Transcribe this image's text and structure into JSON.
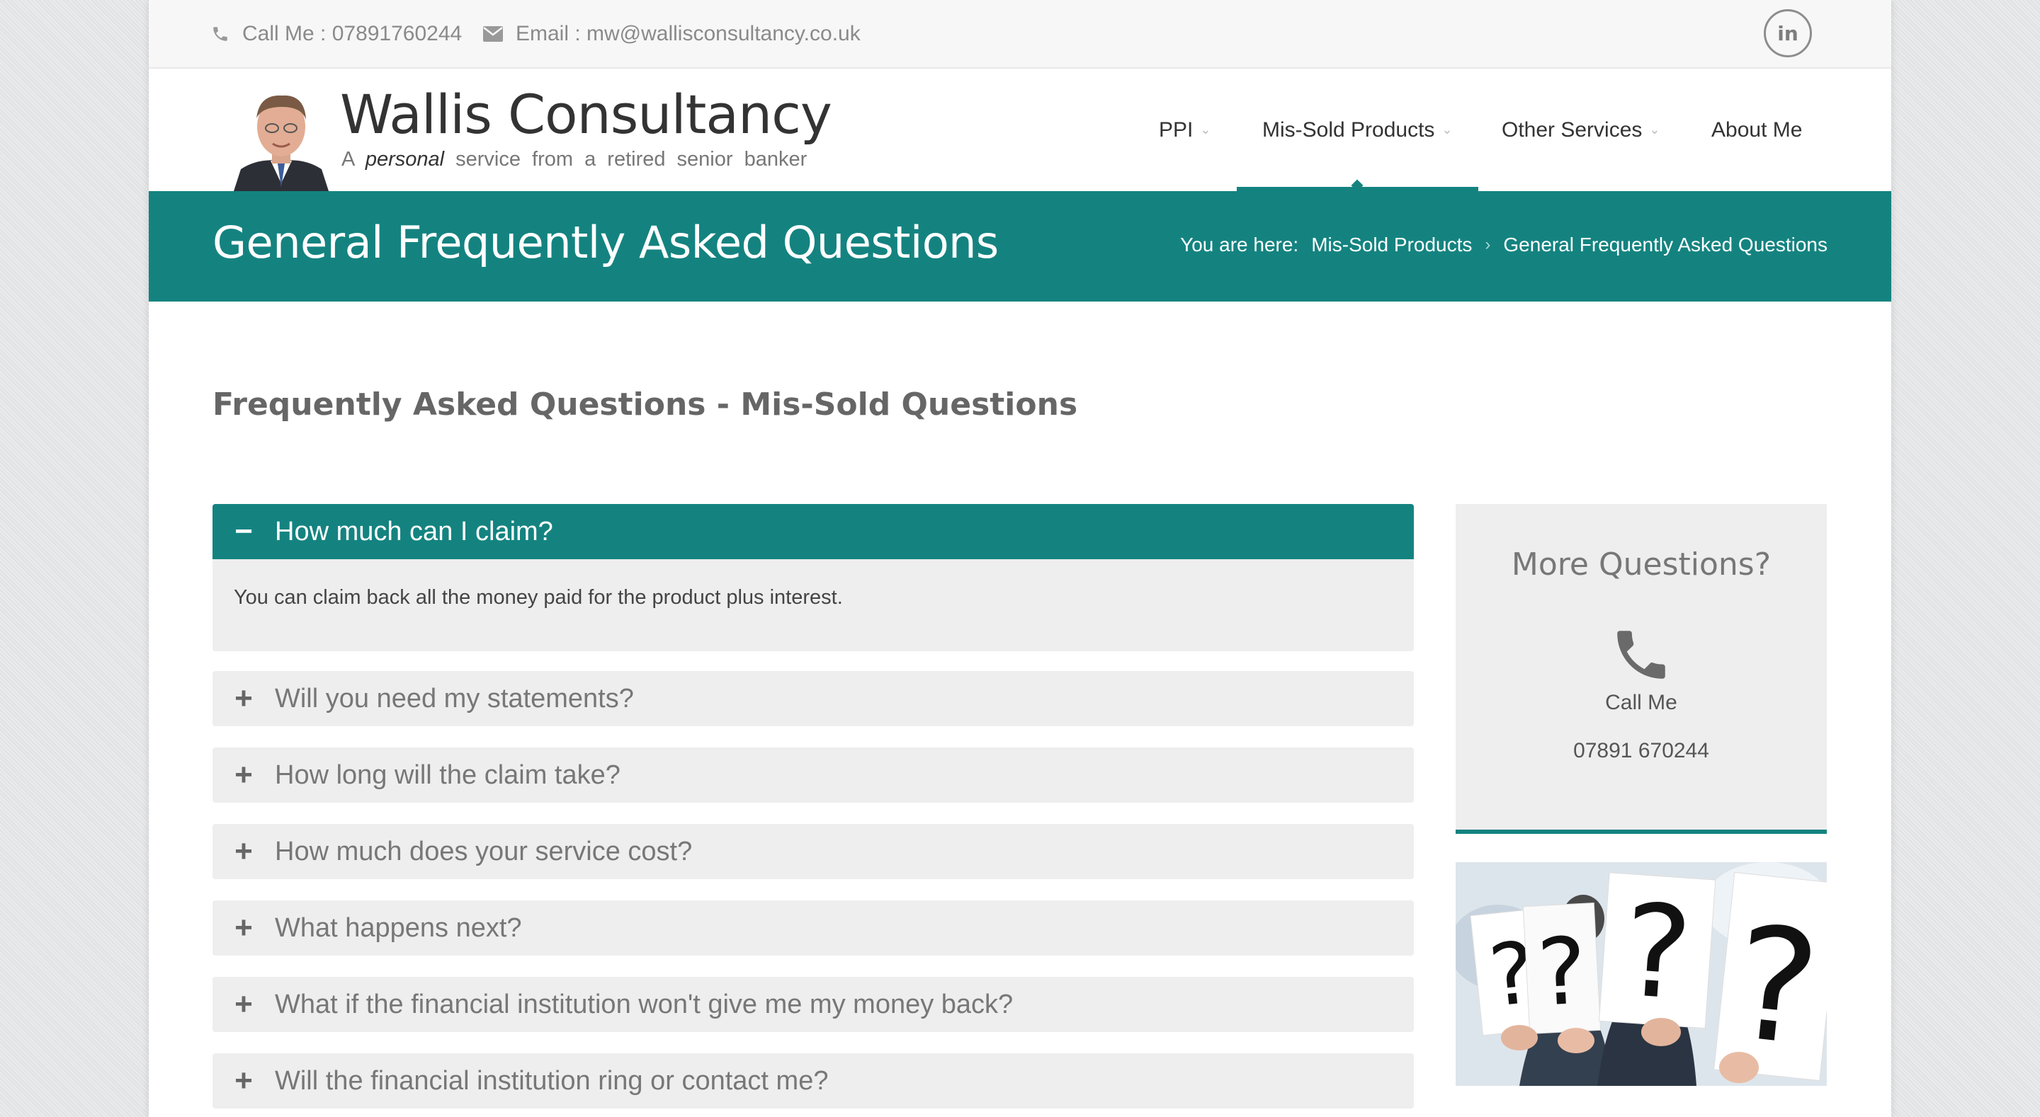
{
  "topbar": {
    "phone_text": "Call Me : 07891760244",
    "email_text": "Email : mw@wallisconsultancy.co.uk",
    "linkedin_label": "in"
  },
  "header": {
    "brand_name": "Wallis Consultancy",
    "tagline_prefix": "A",
    "tagline_emphasis": "personal",
    "tagline_rest": "service from a retired senior banker"
  },
  "nav": {
    "items": [
      {
        "label": "PPI",
        "has_dropdown": true
      },
      {
        "label": "Mis-Sold Products",
        "has_dropdown": true,
        "active": true
      },
      {
        "label": "Other Services",
        "has_dropdown": true
      },
      {
        "label": "About Me",
        "has_dropdown": false
      }
    ]
  },
  "titlebar": {
    "title": "General Frequently Asked Questions",
    "breadcrumb_label": "You are here:",
    "breadcrumb_items": [
      "Mis-Sold Products",
      "General Frequently Asked Questions"
    ]
  },
  "main": {
    "heading": "Frequently Asked Questions - Mis-Sold Questions",
    "faq": [
      {
        "question": "How much can I claim?",
        "open": true,
        "answer": "You can claim back all the money paid for the product plus interest."
      },
      {
        "question": "Will you need my statements?",
        "open": false
      },
      {
        "question": "How long will the claim take?",
        "open": false
      },
      {
        "question": "How much does your service cost?",
        "open": false
      },
      {
        "question": "What happens next?",
        "open": false
      },
      {
        "question": "What if the financial institution won't give me my money back?",
        "open": false
      },
      {
        "question": "Will the financial institution ring or contact me?",
        "open": false
      }
    ]
  },
  "sidebar": {
    "title": "More Questions?",
    "call_label": "Call Me",
    "phone_number": "07891 670244",
    "image_icon": "question-marks-image"
  },
  "colors": {
    "accent": "#148380",
    "panel": "#eeeeee"
  }
}
